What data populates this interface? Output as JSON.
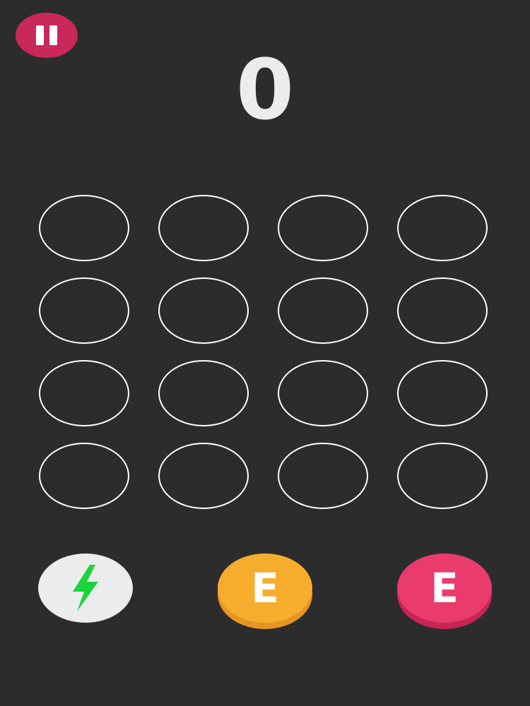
{
  "score": "0",
  "colors": {
    "background": "#2d2c2d",
    "pause_button": "#c9285a",
    "cell_outline": "#ffffff",
    "power_button": "#ececec",
    "bolt": "#19d43a"
  },
  "grid": {
    "rows": 4,
    "cols": 4,
    "filled_cells": 0
  },
  "power_up": {
    "icon": "lightning-bolt-icon"
  },
  "tiles": [
    {
      "letter": "E",
      "face_color": "#f6ad2e",
      "side_color": "#e59620"
    },
    {
      "letter": "E",
      "face_color": "#ea3c6c",
      "side_color": "#c62556"
    }
  ]
}
